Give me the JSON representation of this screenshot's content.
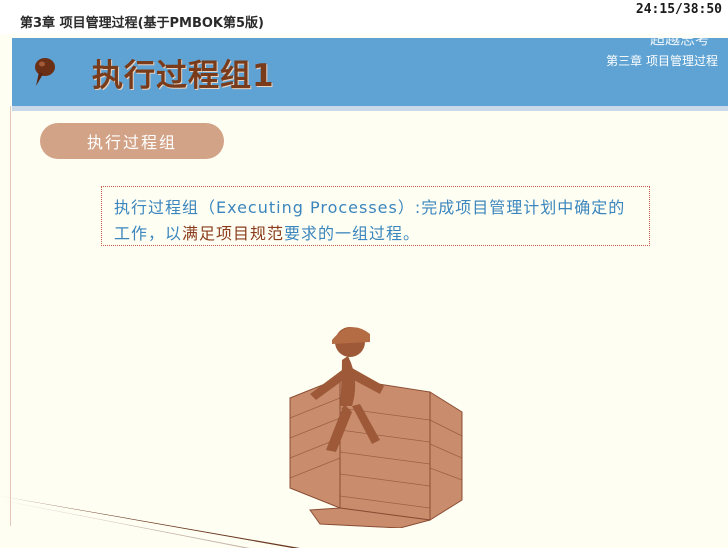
{
  "player": {
    "course_title": "第3章 项目管理过程(基于PMBOK第5版)",
    "timer": "24:15/38:50"
  },
  "header": {
    "title": "执行过程组1",
    "chapter": "第三章 项目管理过程",
    "watermark": "超越思考"
  },
  "section": {
    "pill_label": "执行过程组"
  },
  "definition": {
    "part1": "执行过程组（Executing Processes）:完成项目管理计划中确定的工作，以",
    "emph1": "满足项目规范",
    "part2": "要求的一组过程。"
  },
  "colors": {
    "header_blue": "#5ea3d3",
    "title_brown": "#7a3b1a",
    "pill_tan": "#d3a388",
    "text_blue": "#3b86bd"
  }
}
